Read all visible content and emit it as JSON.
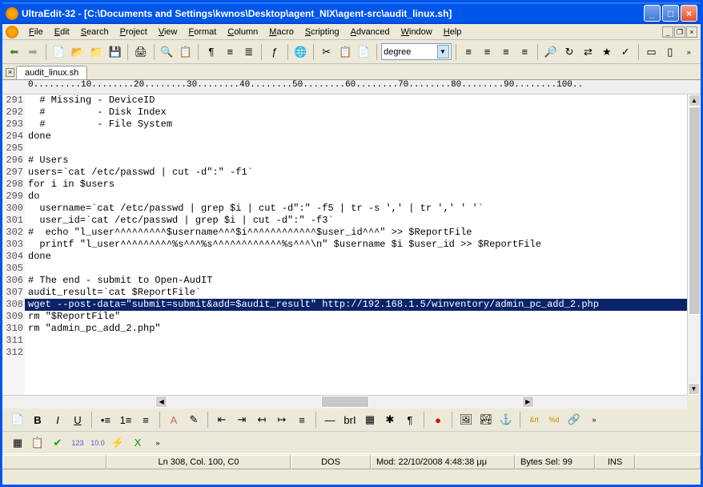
{
  "title": "UltraEdit-32 - [C:\\Documents and Settings\\kwnos\\Desktop\\agent_NIX\\agent-src\\audit_linux.sh]",
  "menus": [
    "File",
    "Edit",
    "Search",
    "Project",
    "View",
    "Format",
    "Column",
    "Macro",
    "Scripting",
    "Advanced",
    "Window",
    "Help"
  ],
  "combo": "degree",
  "tab": "audit_linux.sh",
  "ruler": "0.........10........20........30........40........50........60........70........80........90........100..",
  "lines": [
    {
      "n": 291,
      "t": "  # Missing - DeviceID"
    },
    {
      "n": 292,
      "t": "  #         - Disk Index"
    },
    {
      "n": 293,
      "t": "  #         - File System"
    },
    {
      "n": 294,
      "t": "done"
    },
    {
      "n": 295,
      "t": ""
    },
    {
      "n": 296,
      "t": "# Users"
    },
    {
      "n": 297,
      "t": "users=`cat /etc/passwd | cut -d\":\" -f1`"
    },
    {
      "n": 298,
      "t": "for i in $users"
    },
    {
      "n": 299,
      "t": "do"
    },
    {
      "n": 300,
      "t": "  username=`cat /etc/passwd | grep $i | cut -d\":\" -f5 | tr -s ',' | tr ',' ' '`"
    },
    {
      "n": 301,
      "t": "  user_id=`cat /etc/passwd | grep $i | cut -d\":\" -f3`"
    },
    {
      "n": 302,
      "t": "#  echo \"l_user^^^^^^^^^$username^^^$i^^^^^^^^^^^^$user_id^^^\" >> $ReportFile"
    },
    {
      "n": 303,
      "t": "  printf \"l_user^^^^^^^^^%s^^^%s^^^^^^^^^^^^%s^^^\\n\" $username $i $user_id >> $ReportFile"
    },
    {
      "n": 304,
      "t": "done"
    },
    {
      "n": 305,
      "t": ""
    },
    {
      "n": 306,
      "t": "# The end - submit to Open-AudIT"
    },
    {
      "n": 307,
      "t": "audit_result=`cat $ReportFile`"
    },
    {
      "n": 308,
      "t": "wget --post-data=\"submit=submit&add=$audit_result\" http://192.168.1.5/winventory/admin_pc_add_2.php",
      "sel": true
    },
    {
      "n": 309,
      "t": "rm \"$ReportFile\""
    },
    {
      "n": 310,
      "t": "rm \"admin_pc_add_2.php\""
    },
    {
      "n": 311,
      "t": ""
    },
    {
      "n": 312,
      "t": ""
    }
  ],
  "status": {
    "pos": "Ln 308, Col. 100, C0",
    "enc": "DOS",
    "mod": "Mod: 22/10/2008 4:48:38 μμ",
    "sel": "Bytes Sel: 99",
    "mode": "INS"
  },
  "tb2_labels": [
    "B",
    "I",
    "U"
  ],
  "colors": {
    "accent": "#0055ea"
  }
}
